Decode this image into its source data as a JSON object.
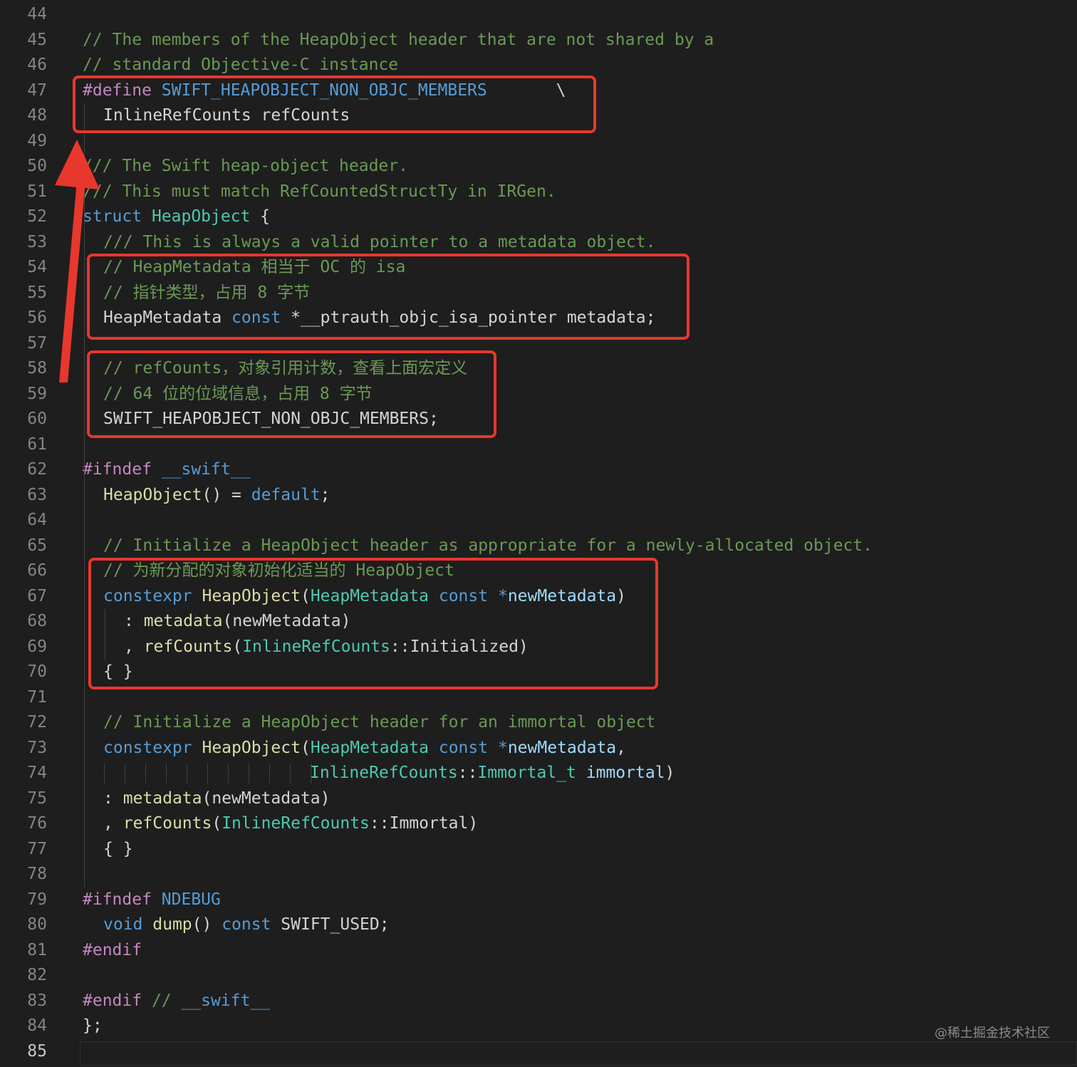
{
  "editor": {
    "lines": [
      {
        "n": "44",
        "indent": 0,
        "tokens": []
      },
      {
        "n": "45",
        "indent": 0,
        "tokens": [
          {
            "t": "// The members of the HeapObject header that are not shared by a",
            "c": "cm"
          }
        ]
      },
      {
        "n": "46",
        "indent": 0,
        "tokens": [
          {
            "t": "// standard Objective-C instance",
            "c": "cm"
          }
        ]
      },
      {
        "n": "47",
        "indent": 0,
        "tokens": [
          {
            "t": "#define ",
            "c": "pp"
          },
          {
            "t": "SWIFT_HEAPOBJECT_NON_OBJC_MEMBERS",
            "c": "kw"
          },
          {
            "t": "       \\",
            "c": "tx"
          }
        ]
      },
      {
        "n": "48",
        "indent": 1,
        "tokens": [
          {
            "t": "InlineRefCounts refCounts",
            "c": "tx"
          }
        ]
      },
      {
        "n": "49",
        "indent": 0,
        "tokens": []
      },
      {
        "n": "50",
        "indent": 0,
        "tokens": [
          {
            "t": "/// The Swift heap-object header.",
            "c": "cm"
          }
        ]
      },
      {
        "n": "51",
        "indent": 0,
        "tokens": [
          {
            "t": "/// This must match RefCountedStructTy in IRGen.",
            "c": "cm"
          }
        ]
      },
      {
        "n": "52",
        "indent": 0,
        "tokens": [
          {
            "t": "struct ",
            "c": "kw"
          },
          {
            "t": "HeapObject",
            "c": "type"
          },
          {
            "t": " {",
            "c": "tx"
          }
        ]
      },
      {
        "n": "53",
        "indent": 1,
        "tokens": [
          {
            "t": "/// This is always a valid pointer to a metadata object.",
            "c": "cm"
          }
        ]
      },
      {
        "n": "54",
        "indent": 1,
        "tokens": [
          {
            "t": "// HeapMetadata 相当于 OC 的 isa",
            "c": "cm"
          }
        ]
      },
      {
        "n": "55",
        "indent": 1,
        "tokens": [
          {
            "t": "// 指针类型，占用 8 字节",
            "c": "cm"
          }
        ]
      },
      {
        "n": "56",
        "indent": 1,
        "tokens": [
          {
            "t": "HeapMetadata ",
            "c": "tx"
          },
          {
            "t": "const",
            "c": "kw"
          },
          {
            "t": " *__ptrauth_objc_isa_pointer metadata;",
            "c": "tx"
          }
        ]
      },
      {
        "n": "57",
        "indent": 0,
        "tokens": []
      },
      {
        "n": "58",
        "indent": 1,
        "tokens": [
          {
            "t": "// refCounts，对象引用计数，查看上面宏定义",
            "c": "cm"
          }
        ]
      },
      {
        "n": "59",
        "indent": 1,
        "tokens": [
          {
            "t": "// 64 位的位域信息，占用 8 字节",
            "c": "cm"
          }
        ]
      },
      {
        "n": "60",
        "indent": 1,
        "tokens": [
          {
            "t": "SWIFT_HEAPOBJECT_NON_OBJC_MEMBERS;",
            "c": "tx"
          }
        ]
      },
      {
        "n": "61",
        "indent": 0,
        "tokens": []
      },
      {
        "n": "62",
        "indent": 0,
        "tokens": [
          {
            "t": "#ifndef ",
            "c": "pp"
          },
          {
            "t": "__swift__",
            "c": "kw"
          }
        ]
      },
      {
        "n": "63",
        "indent": 1,
        "tokens": [
          {
            "t": "HeapObject",
            "c": "fn"
          },
          {
            "t": "() = ",
            "c": "tx"
          },
          {
            "t": "default",
            "c": "kw"
          },
          {
            "t": ";",
            "c": "tx"
          }
        ]
      },
      {
        "n": "64",
        "indent": 0,
        "tokens": []
      },
      {
        "n": "65",
        "indent": 1,
        "tokens": [
          {
            "t": "// Initialize a HeapObject header as appropriate for a newly-allocated object.",
            "c": "cm"
          }
        ]
      },
      {
        "n": "66",
        "indent": 1,
        "tokens": [
          {
            "t": "// 为新分配的对象初始化适当的 HeapObject",
            "c": "cm"
          }
        ]
      },
      {
        "n": "67",
        "indent": 1,
        "tokens": [
          {
            "t": "constexpr ",
            "c": "kw"
          },
          {
            "t": "HeapObject",
            "c": "fn"
          },
          {
            "t": "(",
            "c": "tx"
          },
          {
            "t": "HeapMetadata",
            "c": "type"
          },
          {
            "t": " ",
            "c": "tx"
          },
          {
            "t": "const",
            "c": "kw"
          },
          {
            "t": " *",
            "c": "kw"
          },
          {
            "t": "newMetadata",
            "c": "var"
          },
          {
            "t": ")",
            "c": "tx"
          }
        ]
      },
      {
        "n": "68",
        "indent": 2,
        "tokens": [
          {
            "t": ": ",
            "c": "tx"
          },
          {
            "t": "metadata",
            "c": "fn"
          },
          {
            "t": "(newMetadata)",
            "c": "tx"
          }
        ]
      },
      {
        "n": "69",
        "indent": 2,
        "tokens": [
          {
            "t": ", ",
            "c": "tx"
          },
          {
            "t": "refCounts",
            "c": "fn"
          },
          {
            "t": "(",
            "c": "tx"
          },
          {
            "t": "InlineRefCounts",
            "c": "type"
          },
          {
            "t": "::Initialized)",
            "c": "tx"
          }
        ]
      },
      {
        "n": "70",
        "indent": 1,
        "tokens": [
          {
            "t": "{ }",
            "c": "tx"
          }
        ]
      },
      {
        "n": "71",
        "indent": 0,
        "tokens": []
      },
      {
        "n": "72",
        "indent": 1,
        "tokens": [
          {
            "t": "// Initialize a HeapObject header for an immortal object",
            "c": "cm"
          }
        ]
      },
      {
        "n": "73",
        "indent": 1,
        "tokens": [
          {
            "t": "constexpr ",
            "c": "kw"
          },
          {
            "t": "HeapObject",
            "c": "fn"
          },
          {
            "t": "(",
            "c": "tx"
          },
          {
            "t": "HeapMetadata",
            "c": "type"
          },
          {
            "t": " ",
            "c": "tx"
          },
          {
            "t": "const",
            "c": "kw"
          },
          {
            "t": " *",
            "c": "kw"
          },
          {
            "t": "newMetadata",
            "c": "var"
          },
          {
            "t": ",",
            "c": "tx"
          }
        ]
      },
      {
        "n": "74",
        "indent": 11,
        "tokens": [
          {
            "t": "InlineRefCounts",
            "c": "type"
          },
          {
            "t": "::",
            "c": "tx"
          },
          {
            "t": "Immortal_t",
            "c": "type"
          },
          {
            "t": " ",
            "c": "tx"
          },
          {
            "t": "immortal",
            "c": "var"
          },
          {
            "t": ")",
            "c": "tx"
          }
        ]
      },
      {
        "n": "75",
        "indent": 1,
        "tokens": [
          {
            "t": ": ",
            "c": "tx"
          },
          {
            "t": "metadata",
            "c": "fn"
          },
          {
            "t": "(newMetadata)",
            "c": "tx"
          }
        ]
      },
      {
        "n": "76",
        "indent": 1,
        "tokens": [
          {
            "t": ", ",
            "c": "tx"
          },
          {
            "t": "refCounts",
            "c": "fn"
          },
          {
            "t": "(",
            "c": "tx"
          },
          {
            "t": "InlineRefCounts",
            "c": "type"
          },
          {
            "t": "::Immortal)",
            "c": "tx"
          }
        ]
      },
      {
        "n": "77",
        "indent": 1,
        "tokens": [
          {
            "t": "{ }",
            "c": "tx"
          }
        ]
      },
      {
        "n": "78",
        "indent": 0,
        "tokens": []
      },
      {
        "n": "79",
        "indent": 0,
        "tokens": [
          {
            "t": "#ifndef ",
            "c": "pp"
          },
          {
            "t": "NDEBUG",
            "c": "kw"
          }
        ]
      },
      {
        "n": "80",
        "indent": 1,
        "tokens": [
          {
            "t": "void ",
            "c": "kw"
          },
          {
            "t": "dump",
            "c": "fn"
          },
          {
            "t": "() ",
            "c": "tx"
          },
          {
            "t": "const",
            "c": "kw"
          },
          {
            "t": " SWIFT_USED;",
            "c": "tx"
          }
        ]
      },
      {
        "n": "81",
        "indent": 0,
        "tokens": [
          {
            "t": "#endif",
            "c": "pp"
          }
        ]
      },
      {
        "n": "82",
        "indent": 0,
        "tokens": []
      },
      {
        "n": "83",
        "indent": 0,
        "tokens": [
          {
            "t": "#endif",
            "c": "pp"
          },
          {
            "t": " // ",
            "c": "cm"
          },
          {
            "t": "__swift__",
            "c": "kw"
          }
        ]
      },
      {
        "n": "84",
        "indent": 0,
        "tokens": [
          {
            "t": "};",
            "c": "tx"
          }
        ]
      },
      {
        "n": "85",
        "indent": 0,
        "tokens": [],
        "current": true
      }
    ]
  },
  "annotations": {
    "highlight_color": "#e8372c",
    "arrow_color": "#e8372c"
  },
  "watermark": "@稀土掘金技术社区"
}
